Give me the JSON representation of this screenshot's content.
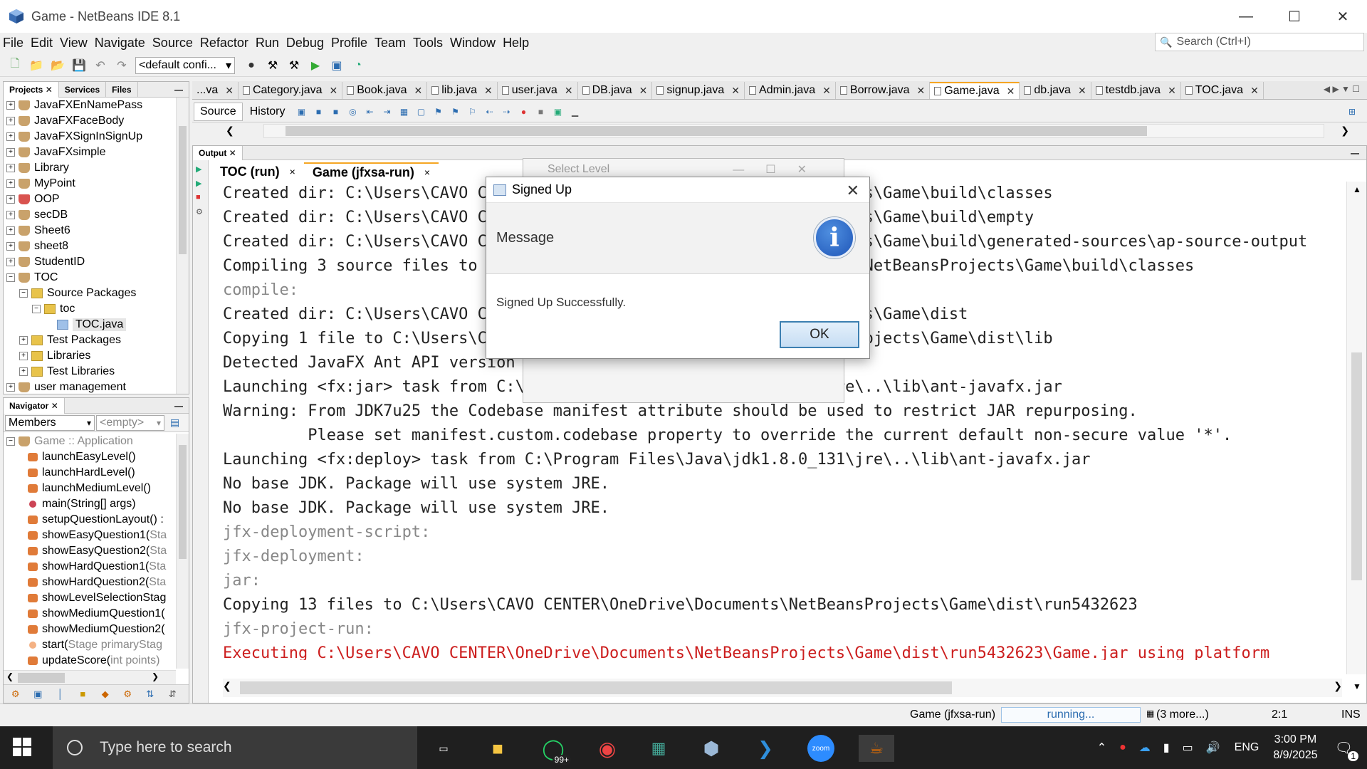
{
  "window": {
    "title": "Game - NetBeans IDE 8.1"
  },
  "menu": [
    "File",
    "Edit",
    "View",
    "Navigate",
    "Source",
    "Refactor",
    "Run",
    "Debug",
    "Profile",
    "Team",
    "Tools",
    "Window",
    "Help"
  ],
  "search": {
    "placeholder": "Search (Ctrl+I)"
  },
  "toolbar": {
    "config": "<default confi..."
  },
  "projects_panel": {
    "tabs": [
      "Projects",
      "Services",
      "Files"
    ],
    "tree": [
      {
        "label": "JavaFXEnNamePass",
        "depth": 0,
        "exp": "+",
        "icon": "cup"
      },
      {
        "label": "JavaFXFaceBody",
        "depth": 0,
        "exp": "+",
        "icon": "cup"
      },
      {
        "label": "JavaFXSignInSignUp",
        "depth": 0,
        "exp": "+",
        "icon": "cup"
      },
      {
        "label": "JavaFXsimple",
        "depth": 0,
        "exp": "+",
        "icon": "cup"
      },
      {
        "label": "Library",
        "depth": 0,
        "exp": "+",
        "icon": "cup"
      },
      {
        "label": "MyPoint",
        "depth": 0,
        "exp": "+",
        "icon": "cup"
      },
      {
        "label": "OOP",
        "depth": 0,
        "exp": "+",
        "icon": "cup-red"
      },
      {
        "label": "secDB",
        "depth": 0,
        "exp": "+",
        "icon": "cup"
      },
      {
        "label": "Sheet6",
        "depth": 0,
        "exp": "+",
        "icon": "cup"
      },
      {
        "label": "sheet8",
        "depth": 0,
        "exp": "+",
        "icon": "cup"
      },
      {
        "label": "StudentID",
        "depth": 0,
        "exp": "+",
        "icon": "cup"
      },
      {
        "label": "TOC",
        "depth": 0,
        "exp": "−",
        "icon": "cup"
      },
      {
        "label": "Source Packages",
        "depth": 1,
        "exp": "−",
        "icon": "pkg"
      },
      {
        "label": "toc",
        "depth": 2,
        "exp": "−",
        "icon": "pkg"
      },
      {
        "label": "TOC.java",
        "depth": 3,
        "exp": "",
        "icon": "file"
      },
      {
        "label": "Test Packages",
        "depth": 1,
        "exp": "+",
        "icon": "pkg"
      },
      {
        "label": "Libraries",
        "depth": 1,
        "exp": "+",
        "icon": "pkg"
      },
      {
        "label": "Test Libraries",
        "depth": 1,
        "exp": "+",
        "icon": "pkg"
      },
      {
        "label": "user management",
        "depth": 0,
        "exp": "+",
        "icon": "cup"
      }
    ]
  },
  "navigator": {
    "tab": "Navigator",
    "members_label": "Members",
    "filter_label": "<empty>",
    "root": "Game :: Application",
    "methods": [
      {
        "name": "launchEasyLevel()",
        "extra": "",
        "kind": "m"
      },
      {
        "name": "launchHardLevel()",
        "extra": "",
        "kind": "m"
      },
      {
        "name": "launchMediumLevel()",
        "extra": "",
        "kind": "m"
      },
      {
        "name": "main(String[] args)",
        "extra": "",
        "kind": "static"
      },
      {
        "name": "setupQuestionLayout() :",
        "extra": "",
        "kind": "m"
      },
      {
        "name": "showEasyQuestion1(",
        "extra": "Sta",
        "kind": "m"
      },
      {
        "name": "showEasyQuestion2(",
        "extra": "Sta",
        "kind": "m"
      },
      {
        "name": "showHardQuestion1(",
        "extra": "Sta",
        "kind": "m"
      },
      {
        "name": "showHardQuestion2(",
        "extra": "Sta",
        "kind": "m"
      },
      {
        "name": "showLevelSelectionStag",
        "extra": "",
        "kind": "m"
      },
      {
        "name": "showMediumQuestion1(",
        "extra": "",
        "kind": "m"
      },
      {
        "name": "showMediumQuestion2(",
        "extra": "",
        "kind": "m"
      },
      {
        "name": "start(",
        "extra": "Stage primaryStag",
        "kind": "priv"
      },
      {
        "name": "updateScore(",
        "extra": "int points)",
        "kind": "m"
      }
    ]
  },
  "editor_tabs": [
    {
      "label": "...va",
      "active": false
    },
    {
      "label": "Category.java",
      "active": false
    },
    {
      "label": "Book.java",
      "active": false
    },
    {
      "label": "lib.java",
      "active": false
    },
    {
      "label": "user.java",
      "active": false
    },
    {
      "label": "DB.java",
      "active": false
    },
    {
      "label": "signup.java",
      "active": false
    },
    {
      "label": "Admin.java",
      "active": false
    },
    {
      "label": "Borrow.java",
      "active": false
    },
    {
      "label": "Game.java",
      "active": true
    },
    {
      "label": "db.java",
      "active": false
    },
    {
      "label": "testdb.java",
      "active": false
    },
    {
      "label": "TOC.java",
      "active": false
    }
  ],
  "editor_toolbar": {
    "source": "Source",
    "history": "History"
  },
  "output": {
    "tab": "Output",
    "subtabs": [
      "TOC (run)",
      "Game (jfxsa-run)"
    ],
    "lines": [
      {
        "t": "Created dir: C:\\Users\\CAVO CENTER\\OneDrive\\Documents\\NetBeansProjects\\Game\\build\\classes",
        "c": "l-norm"
      },
      {
        "t": "Created dir: C:\\Users\\CAVO CENTER\\OneDrive\\Documents\\NetBeansProjects\\Game\\build\\empty",
        "c": "l-norm"
      },
      {
        "t": "Created dir: C:\\Users\\CAVO CENTER\\OneDrive\\Documents\\NetBeansProjects\\Game\\build\\generated-sources\\ap-source-output",
        "c": "l-norm"
      },
      {
        "t": "Compiling 3 source files to C:\\Users\\CAVO CENTER\\OneDrive\\Documents\\NetBeansProjects\\Game\\build\\classes",
        "c": "l-norm"
      },
      {
        "t": "compile:",
        "c": "l-gray"
      },
      {
        "t": "Created dir: C:\\Users\\CAVO CENTER\\OneDrive\\Documents\\NetBeansProjects\\Game\\dist",
        "c": "l-norm"
      },
      {
        "t": "Copying 1 file to C:\\Users\\CAVO CENTER\\OneDrive\\Documents\\NetBeansProjects\\Game\\dist\\lib",
        "c": "l-norm"
      },
      {
        "t": "Detected JavaFX Ant API version 1.3",
        "c": "l-norm"
      },
      {
        "t": "Launching <fx:jar> task from C:\\Program Files\\Java\\jdk1.8.0_131\\jre\\..\\lib\\ant-javafx.jar",
        "c": "l-norm"
      },
      {
        "t": "Warning: From JDK7u25 the Codebase manifest attribute should be used to restrict JAR repurposing.",
        "c": "l-norm"
      },
      {
        "t": "         Please set manifest.custom.codebase property to override the current default non-secure value '*'.",
        "c": "l-norm"
      },
      {
        "t": "Launching <fx:deploy> task from C:\\Program Files\\Java\\jdk1.8.0_131\\jre\\..\\lib\\ant-javafx.jar",
        "c": "l-norm"
      },
      {
        "t": "No base JDK. Package will use system JRE.",
        "c": "l-norm"
      },
      {
        "t": "No base JDK. Package will use system JRE.",
        "c": "l-norm"
      },
      {
        "t": "jfx-deployment-script:",
        "c": "l-gray"
      },
      {
        "t": "jfx-deployment:",
        "c": "l-gray"
      },
      {
        "t": "jar:",
        "c": "l-gray"
      },
      {
        "t": "Copying 13 files to C:\\Users\\CAVO CENTER\\OneDrive\\Documents\\NetBeansProjects\\Game\\dist\\run5432623",
        "c": "l-norm"
      },
      {
        "t": "jfx-project-run:",
        "c": "l-gray"
      },
      {
        "t": "Executing C:\\Users\\CAVO CENTER\\OneDrive\\Documents\\NetBeansProjects\\Game\\dist\\run5432623\\Game.jar using platform",
        "c": "l-red"
      }
    ]
  },
  "background_window": {
    "title": "Select Level"
  },
  "dialog": {
    "title": "Signed Up",
    "header": "Message",
    "message": "Signed Up Successfully.",
    "ok": "OK"
  },
  "status_bar": {
    "task": "Game (jfxsa-run)",
    "progress_label": "running...",
    "more": "(3 more...)",
    "position": "2:1",
    "mode": "INS"
  },
  "taskbar": {
    "search_placeholder": "Type here to search",
    "whatsapp_badge": "99+",
    "lang": "ENG",
    "time": "3:00 PM",
    "date": "8/9/2025",
    "notification_count": "1"
  }
}
